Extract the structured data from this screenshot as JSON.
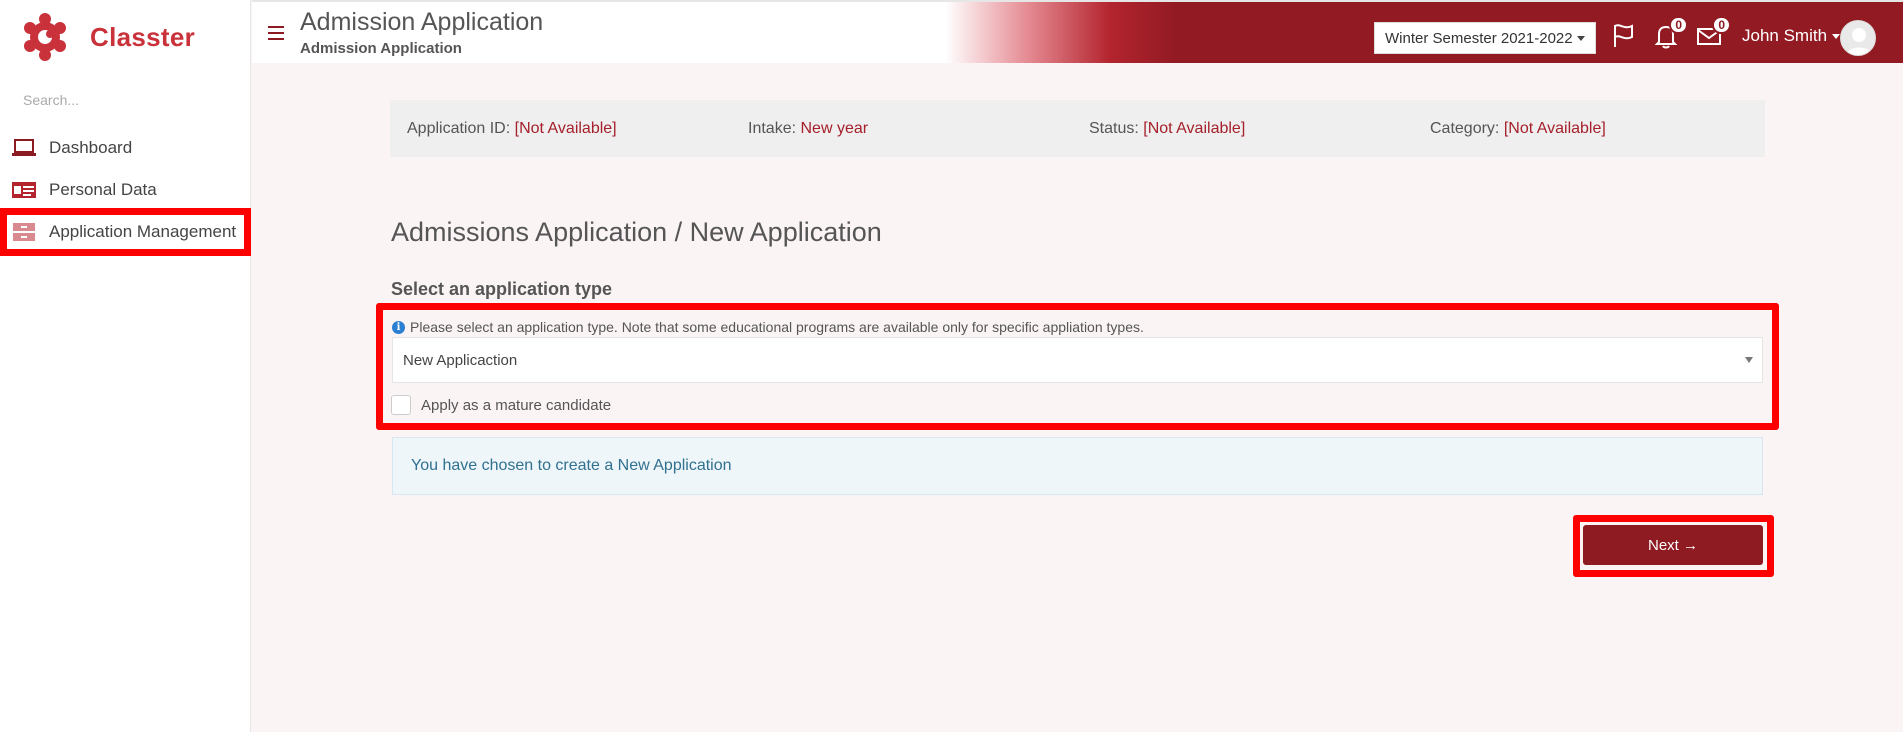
{
  "brand": {
    "name": "Classter"
  },
  "sidebar": {
    "search_placeholder": "Search...",
    "items": [
      {
        "label": "Dashboard",
        "icon": "laptop-icon"
      },
      {
        "label": "Personal Data",
        "icon": "id-card-icon"
      },
      {
        "label": "Application Management",
        "icon": "drawer-icon",
        "selected": true
      }
    ]
  },
  "header": {
    "title": "Admission Application",
    "subtitle": "Admission Application",
    "semester": "Winter Semester 2021-2022",
    "notifications_count": "0",
    "messages_count": "0",
    "user_name": "John Smith"
  },
  "info": {
    "application_id_label": "Application ID:",
    "application_id_value": "[Not Available]",
    "intake_label": "Intake:",
    "intake_value": "New year",
    "status_label": "Status:",
    "status_value": "[Not Available]",
    "category_label": "Category:",
    "category_value": "[Not Available]"
  },
  "main": {
    "heading": "Admissions Application / New Application",
    "section_title": "Select an application type",
    "help_text": "Please select an application type. Note that some educational programs are available only for specific appliation types.",
    "selected_type": "New Applicaction",
    "mature_label": "Apply as a mature candidate",
    "alert_text": "You have chosen to create a New Application",
    "next_label": "Next →"
  },
  "colors": {
    "accent": "#921a23",
    "value_red": "#a5202b",
    "highlight": "#ff0000"
  }
}
